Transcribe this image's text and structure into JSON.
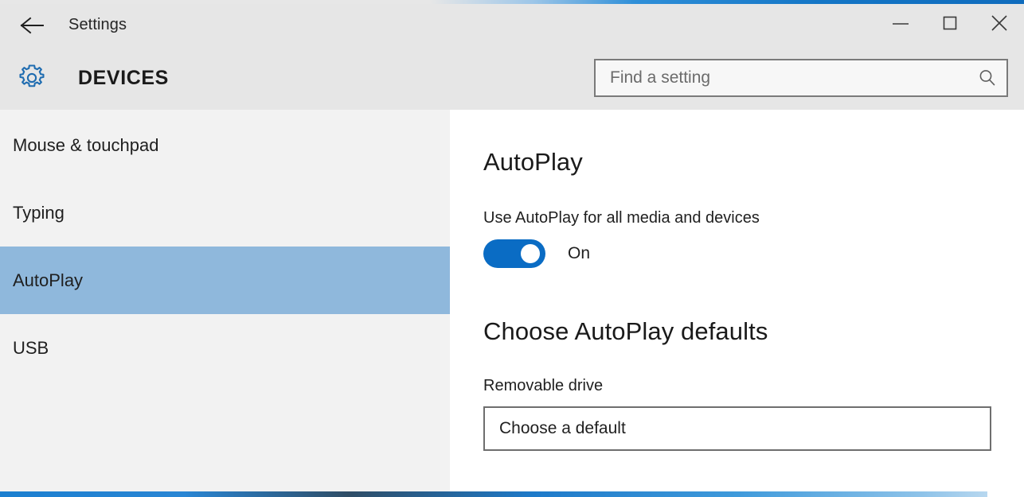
{
  "window": {
    "title": "Settings",
    "back_icon": "back-arrow-icon",
    "caption": {
      "minimize": "–",
      "maximize": "□",
      "close": "✕"
    }
  },
  "header": {
    "icon": "gear-icon",
    "title": "DEVICES",
    "search": {
      "placeholder": "Find a setting",
      "value": "",
      "icon": "search-icon"
    }
  },
  "sidebar": {
    "items": [
      {
        "label": "Mouse & touchpad",
        "selected": false
      },
      {
        "label": "Typing",
        "selected": false
      },
      {
        "label": "AutoPlay",
        "selected": true
      },
      {
        "label": "USB",
        "selected": false
      }
    ]
  },
  "main": {
    "section_title": "AutoPlay",
    "toggle_label": "Use AutoPlay for all media and devices",
    "toggle_state": "On",
    "toggle_on": true,
    "defaults_title": "Choose AutoPlay defaults",
    "removable_drive_label": "Removable drive",
    "removable_drive_value": "Choose a default"
  },
  "colors": {
    "accent_blue": "#0a6cc4",
    "selection_blue": "#8fb8dc",
    "chrome_gray": "#e6e6e6",
    "sidebar_gray": "#f2f2f2"
  }
}
